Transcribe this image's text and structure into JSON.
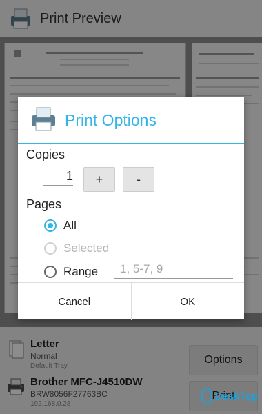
{
  "header": {
    "title": "Print Preview",
    "icon": "printer-icon"
  },
  "dialog": {
    "title": "Print Options",
    "copies_label": "Copies",
    "copies_value": "1",
    "plus_label": "+",
    "minus_label": "-",
    "pages_label": "Pages",
    "options": [
      {
        "label": "All",
        "checked": true,
        "disabled": false
      },
      {
        "label": "Selected",
        "checked": false,
        "disabled": true
      },
      {
        "label": "Range",
        "checked": false,
        "disabled": false
      }
    ],
    "range_placeholder": "1, 5-7, 9",
    "cancel_label": "Cancel",
    "ok_label": "OK"
  },
  "paper": {
    "title": "Letter",
    "type": "Normal",
    "tray": "Default Tray"
  },
  "printer": {
    "name": "Brother MFC-J4510DW",
    "id": "BRW8056F27763BC",
    "ip": "192.168.0.28"
  },
  "buttons": {
    "options": "Options",
    "print": "Print"
  },
  "watermark": {
    "text": "DeskTop"
  },
  "colors": {
    "accent": "#33b5e5"
  }
}
